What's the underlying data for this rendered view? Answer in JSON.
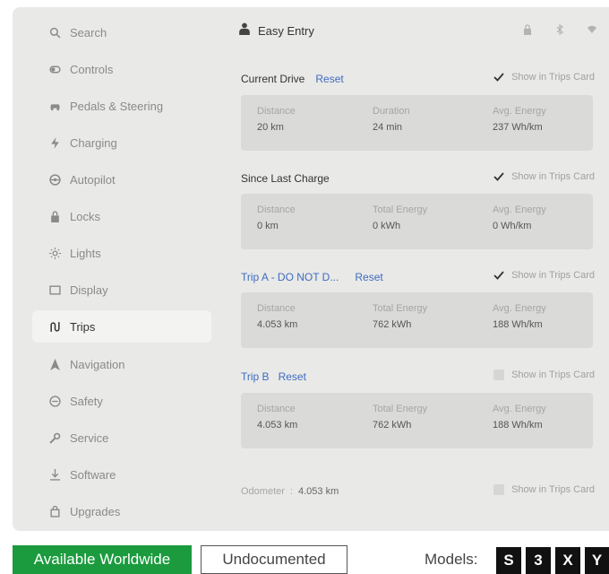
{
  "sidebar": {
    "items": [
      {
        "label": "Search",
        "icon": "search-icon"
      },
      {
        "label": "Controls",
        "icon": "toggle-icon"
      },
      {
        "label": "Pedals & Steering",
        "icon": "car-icon"
      },
      {
        "label": "Charging",
        "icon": "bolt-icon"
      },
      {
        "label": "Autopilot",
        "icon": "steering-wheel-icon"
      },
      {
        "label": "Locks",
        "icon": "lock-icon"
      },
      {
        "label": "Lights",
        "icon": "sun-icon"
      },
      {
        "label": "Display",
        "icon": "display-icon"
      },
      {
        "label": "Trips",
        "icon": "trips-icon"
      },
      {
        "label": "Navigation",
        "icon": "navigation-icon"
      },
      {
        "label": "Safety",
        "icon": "safety-icon"
      },
      {
        "label": "Service",
        "icon": "wrench-icon"
      },
      {
        "label": "Software",
        "icon": "download-icon"
      },
      {
        "label": "Upgrades",
        "icon": "bag-icon"
      }
    ],
    "active": "Trips"
  },
  "header": {
    "title": "Easy Entry"
  },
  "show_in_trips_label": "Show in Trips Card",
  "sections": {
    "current": {
      "title": "Current Drive",
      "reset": "Reset",
      "show_checked": true,
      "stats": [
        {
          "label": "Distance",
          "value": "20 km"
        },
        {
          "label": "Duration",
          "value": "24 min"
        },
        {
          "label": "Avg. Energy",
          "value": "237 Wh/km"
        }
      ]
    },
    "since": {
      "title": "Since Last Charge",
      "show_checked": true,
      "stats": [
        {
          "label": "Distance",
          "value": "0 km"
        },
        {
          "label": "Total Energy",
          "value": "0 kWh"
        },
        {
          "label": "Avg. Energy",
          "value": "0 Wh/km"
        }
      ]
    },
    "tripa": {
      "title": "Trip A - DO NOT D...",
      "reset": "Reset",
      "show_checked": true,
      "stats": [
        {
          "label": "Distance",
          "value": "4.053 km"
        },
        {
          "label": "Total Energy",
          "value": "762 kWh"
        },
        {
          "label": "Avg. Energy",
          "value": "188 Wh/km"
        }
      ]
    },
    "tripb": {
      "title": "Trip B",
      "reset": "Reset",
      "show_checked": false,
      "stats": [
        {
          "label": "Distance",
          "value": "4.053 km"
        },
        {
          "label": "Total Energy",
          "value": "762 kWh"
        },
        {
          "label": "Avg. Energy",
          "value": "188 Wh/km"
        }
      ]
    }
  },
  "odometer": {
    "label": "Odometer",
    "value": "4.053 km",
    "show_checked": false
  },
  "footer": {
    "availability": "Available Worldwide",
    "status": "Undocumented",
    "models_label": "Models:",
    "models": [
      "S",
      "3",
      "X",
      "Y"
    ]
  },
  "colors": {
    "screen_bg": "#e9e9e7",
    "link": "#3f6bc2",
    "badge_green": "#1b9b3e"
  }
}
